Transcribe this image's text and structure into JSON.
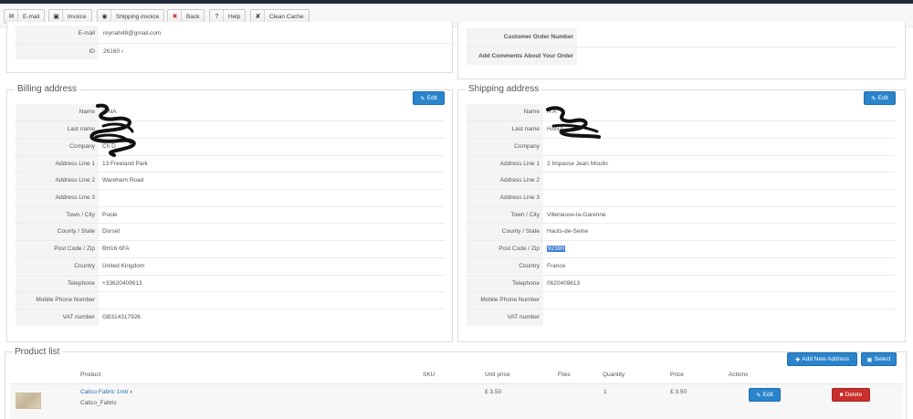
{
  "toolbar": {
    "email": "E-mail",
    "invoice": "Invoice",
    "shipping_invoice": "Shipping invoice",
    "back": "Back",
    "help": "Help",
    "clean_cache": "Clean Cache"
  },
  "customer": {
    "email_label": "E-mail",
    "email_value": "reynah48@gmail.com",
    "id_label": "ID",
    "id_value": "26160"
  },
  "order_info": {
    "customer_order_number": "Customer Order Number",
    "add_comments": "Add Comments About Your Order"
  },
  "billing": {
    "title": "Billing address",
    "edit": "Edit",
    "rows": [
      {
        "label": "Name",
        "value": "R   NA"
      },
      {
        "label": "Last name",
        "value": ""
      },
      {
        "label": "Company",
        "value": "Ch        D"
      },
      {
        "label": "Address Line 1",
        "value": "13 Freeland Park"
      },
      {
        "label": "Address Line 2",
        "value": "Wareham Road"
      },
      {
        "label": "Address Line 3",
        "value": ""
      },
      {
        "label": "Town / City",
        "value": "Poole"
      },
      {
        "label": "County / State",
        "value": "Dorset"
      },
      {
        "label": "Post Code / Zip",
        "value": "BH16 6FA"
      },
      {
        "label": "Country",
        "value": "United Kingdom"
      },
      {
        "label": "Telephone",
        "value": "+33620409613"
      },
      {
        "label": "Mobile Phone Number",
        "value": ""
      },
      {
        "label": "VAT number",
        "value": "GB314317926"
      }
    ]
  },
  "shipping": {
    "title": "Shipping address",
    "edit": "Edit",
    "rows": [
      {
        "label": "Name",
        "value": "R   A"
      },
      {
        "label": "Last name",
        "value": "HANA"
      },
      {
        "label": "Company",
        "value": ""
      },
      {
        "label": "Address Line 1",
        "value": "2 Impasse Jean Moulin"
      },
      {
        "label": "Address Line 2",
        "value": ""
      },
      {
        "label": "Address Line 3",
        "value": ""
      },
      {
        "label": "Town / City",
        "value": "Villeneuve-la-Garenne"
      },
      {
        "label": "County / State",
        "value": "Hauts-de-Seine"
      },
      {
        "label": "Post Code / Zip",
        "value": "92390"
      },
      {
        "label": "Country",
        "value": "France"
      },
      {
        "label": "Telephone",
        "value": "0620409613"
      },
      {
        "label": "Mobile Phone Number",
        "value": ""
      },
      {
        "label": "VAT number",
        "value": ""
      }
    ]
  },
  "products": {
    "title": "Product list",
    "add_new_address": "Add New Address",
    "select": "Select",
    "headers": [
      "Product",
      "SKU",
      "Unit price",
      "Files",
      "Quantity",
      "Price",
      "Actions"
    ],
    "items": [
      {
        "name": "Calico Fabric 1mtr",
        "subname": "Calico_Fabric",
        "sku": "",
        "unit_price": "£ 3.50",
        "files": "",
        "quantity": "1",
        "price": "£ 3.50",
        "edit": "Edit",
        "delete": "Delete"
      }
    ]
  }
}
